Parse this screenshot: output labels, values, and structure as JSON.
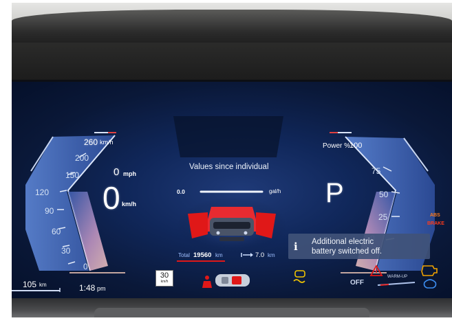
{
  "speed": {
    "max": "260",
    "max_unit": "km/h",
    "ticks": [
      "200",
      "150",
      "120",
      "90",
      "60",
      "30",
      "0"
    ],
    "mph_value": "0",
    "mph_unit": "mph",
    "kmh_value": "0",
    "kmh_unit": "km/h"
  },
  "trip": {
    "title": "Values since individual",
    "consumption_value": "0.0",
    "consumption_unit": "gal/h",
    "total_label": "Total",
    "total_value": "19560",
    "total_unit": "km",
    "distance_value": "7.0",
    "distance_unit": "km"
  },
  "power": {
    "label": "Power %",
    "max": "100",
    "ticks": [
      "75",
      "50",
      "25",
      "0"
    ]
  },
  "gear": "P",
  "notification": {
    "line1": "Additional electric",
    "line2": "battery switched off."
  },
  "bottom": {
    "range_value": "105",
    "range_unit": "km",
    "time": "1:48",
    "time_suffix": "pm",
    "speed_limit_value": "30",
    "speed_limit_unit": "km/h",
    "off_label": "OFF",
    "warmup_label": "WARM-UP"
  },
  "warnings": {
    "abs": "ABS",
    "brake": "BRAKE"
  },
  "colors": {
    "accent_blue": "#3d6fd1",
    "warning_red": "#e01818",
    "warning_orange": "#ff7a1a",
    "warning_yellow": "#f2c400"
  },
  "icons": [
    "info-icon",
    "seatbelt-icon",
    "car-top-view-icon",
    "car-doors-open-icon",
    "hazard-triangle-icon",
    "engine-check-icon",
    "tire-pressure-icon",
    "arrow-right-icon"
  ]
}
